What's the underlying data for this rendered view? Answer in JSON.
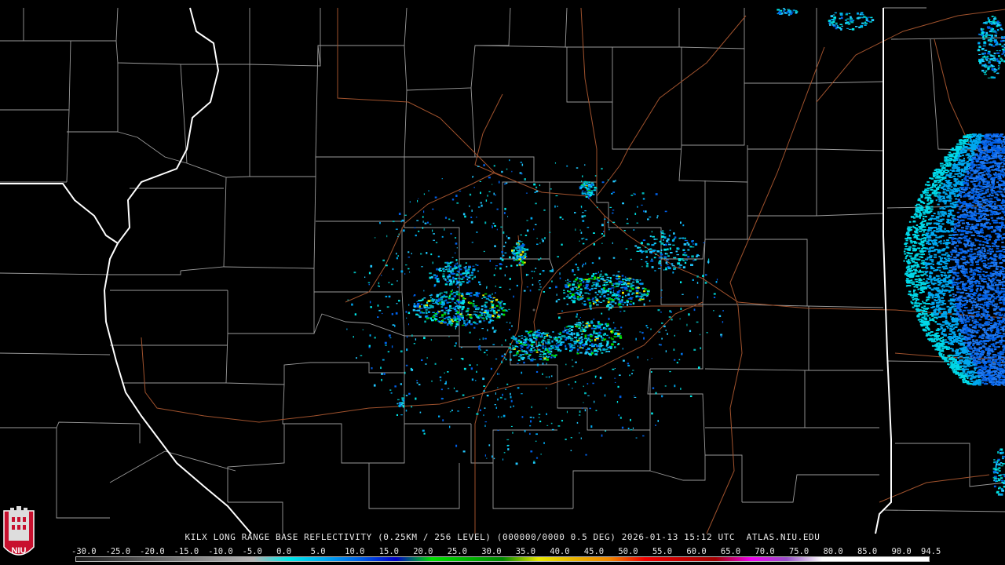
{
  "title": {
    "station": "KILX",
    "product": "LONG RANGE BASE REFLECTIVITY",
    "resolution": "(0.25KM / 256 LEVEL)",
    "volume": "(000000/0000 0.5 DEG)",
    "datetime": "2026-01-13 15:12 UTC",
    "source": "ATLAS.NIU.EDU"
  },
  "logo": {
    "text": "NIU",
    "color": "#c8102e"
  },
  "color_scale": {
    "labels": [
      "-30.0",
      "-25.0",
      "-20.0",
      "-15.0",
      "-10.0",
      "-5.0",
      "0.0",
      "5.0",
      "10.0",
      "15.0",
      "20.0",
      "25.0",
      "30.0",
      "35.0",
      "40.0",
      "45.0",
      "50.0",
      "55.0",
      "60.0",
      "65.0",
      "70.0",
      "75.0",
      "80.0",
      "85.0",
      "90.0",
      "94.5"
    ],
    "colors": [
      "#1a1a1a",
      "#3a3a3a",
      "#5a5a5a",
      "#7a7a7a",
      "#9a9a9a",
      "#b4b4b4",
      "#00e8e8",
      "#00a8f0",
      "#0060e8",
      "#0000c8",
      "#00e000",
      "#00b400",
      "#008800",
      "#e8e800",
      "#e8b400",
      "#f08800",
      "#f00000",
      "#c80000",
      "#a00000",
      "#f000f0",
      "#9850c8",
      "#ffffff",
      "#ffffff",
      "#ffffff",
      "#ffffff"
    ]
  },
  "radar_site": {
    "name": "KILX"
  },
  "map_colors": {
    "county": "#9a9a9a",
    "state": "#ffffff",
    "highway": "#a0522d"
  }
}
